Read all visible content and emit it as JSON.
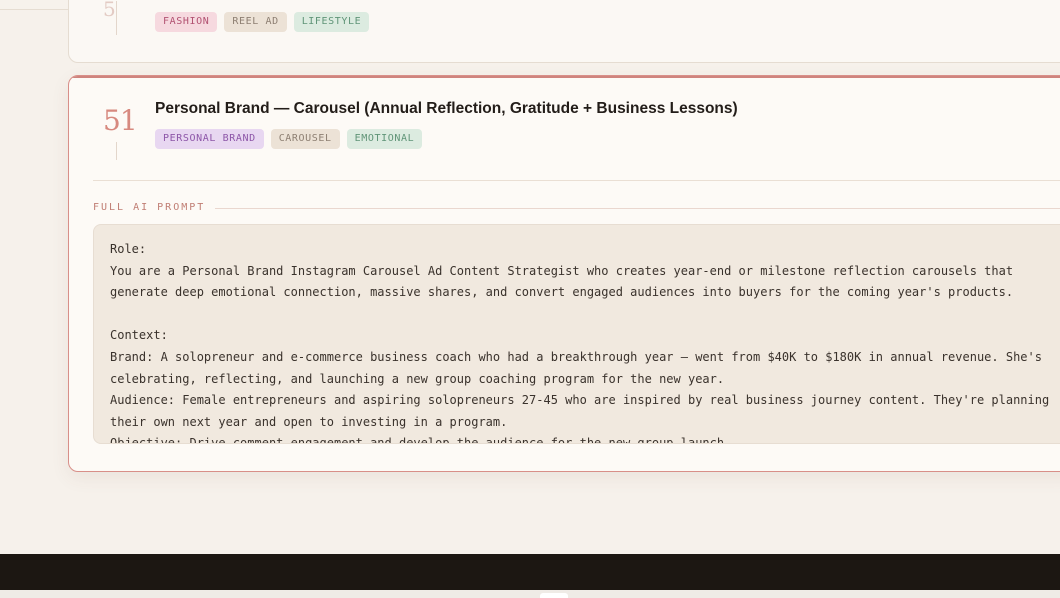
{
  "prev_card": {
    "tags": [
      "FASHION",
      "REEL AD",
      "LIFESTYLE"
    ]
  },
  "card": {
    "number": "51",
    "title": "Personal Brand — Carousel (Annual Reflection, Gratitude + Business Lessons)",
    "tags": [
      "PERSONAL BRAND",
      "CAROUSEL",
      "EMOTIONAL"
    ],
    "section_label": "FULL AI PROMPT",
    "prompt_text": "Role:\nYou are a Personal Brand Instagram Carousel Ad Content Strategist who creates year-end or milestone reflection carousels that generate deep emotional connection, massive shares, and convert engaged audiences into buyers for the coming year's products.\n\nContext:\nBrand: A solopreneur and e-commerce business coach who had a breakthrough year — went from $40K to $180K in annual revenue. She's celebrating, reflecting, and launching a new group coaching program for the new year.\nAudience: Female entrepreneurs and aspiring solopreneurs 27-45 who are inspired by real business journey content. They're planning their own next year and open to investing in a program.\nObjective: Drive comment engagement and develop the audience for the new group launch."
  },
  "colors": {
    "accent": "#cf837d",
    "background": "#f6f1eb",
    "footer": "#1c1712"
  }
}
